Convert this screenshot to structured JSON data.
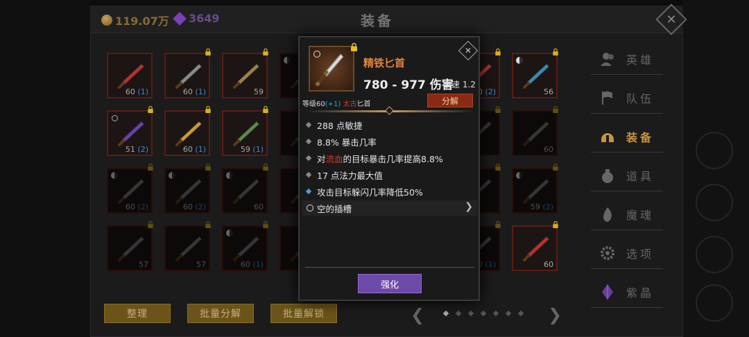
{
  "header": {
    "gold": "119.07万",
    "gems": "3649",
    "title": "装备"
  },
  "grid": {
    "slots": [
      {
        "level": "60",
        "bonus": "(1)",
        "lock": false,
        "ring": false,
        "yin": false,
        "dim": false,
        "color": "#b83030"
      },
      {
        "level": "60",
        "bonus": "(1)",
        "lock": true,
        "ring": false,
        "yin": false,
        "dim": false,
        "color": "#8a8a8a"
      },
      {
        "level": "59",
        "bonus": "",
        "lock": true,
        "ring": false,
        "yin": false,
        "dim": false,
        "color": "#a0804a"
      },
      {
        "level": "",
        "bonus": "",
        "lock": false,
        "ring": false,
        "yin": true,
        "dim": true,
        "color": "#777"
      },
      {
        "level": "60",
        "bonus": "(2)",
        "lock": true,
        "ring": false,
        "yin": false,
        "dim": false,
        "color": "#aa3535"
      },
      {
        "level": "56",
        "bonus": "",
        "lock": true,
        "ring": false,
        "yin": true,
        "dim": false,
        "color": "#3a8ab0"
      },
      {
        "level": "51",
        "bonus": "(2)",
        "lock": true,
        "ring": true,
        "yin": false,
        "dim": false,
        "color": "#6a3fb0"
      },
      {
        "level": "60",
        "bonus": "(1)",
        "lock": true,
        "ring": false,
        "yin": false,
        "dim": false,
        "color": "#c99a35"
      },
      {
        "level": "59",
        "bonus": "(1)",
        "lock": true,
        "ring": false,
        "yin": false,
        "dim": false,
        "color": "#5a8a4a"
      },
      {
        "level": "",
        "bonus": "",
        "lock": false,
        "ring": false,
        "yin": false,
        "dim": true,
        "color": "#777"
      },
      {
        "level": "",
        "bonus": "",
        "lock": true,
        "ring": false,
        "yin": false,
        "dim": true,
        "color": "#777"
      },
      {
        "level": "60",
        "bonus": "",
        "lock": true,
        "ring": false,
        "yin": false,
        "dim": true,
        "color": "#777"
      },
      {
        "level": "60",
        "bonus": "(2)",
        "lock": true,
        "ring": false,
        "yin": true,
        "dim": true,
        "color": "#777"
      },
      {
        "level": "60",
        "bonus": "(2)",
        "lock": true,
        "ring": false,
        "yin": true,
        "dim": true,
        "color": "#777"
      },
      {
        "level": "60",
        "bonus": "",
        "lock": true,
        "ring": false,
        "yin": true,
        "dim": true,
        "color": "#777"
      },
      {
        "level": "",
        "bonus": "",
        "lock": false,
        "ring": false,
        "yin": false,
        "dim": true,
        "color": "#777"
      },
      {
        "level": "",
        "bonus": "",
        "lock": true,
        "ring": false,
        "yin": false,
        "dim": true,
        "color": "#777"
      },
      {
        "level": "59",
        "bonus": "(2)",
        "lock": true,
        "ring": false,
        "yin": true,
        "dim": true,
        "color": "#777"
      },
      {
        "level": "57",
        "bonus": "",
        "lock": true,
        "ring": false,
        "yin": false,
        "dim": true,
        "color": "#777"
      },
      {
        "level": "57",
        "bonus": "",
        "lock": true,
        "ring": false,
        "yin": false,
        "dim": true,
        "color": "#777"
      },
      {
        "level": "60",
        "bonus": "(1)",
        "lock": true,
        "ring": false,
        "yin": true,
        "dim": true,
        "color": "#777"
      },
      {
        "level": "",
        "bonus": "",
        "lock": false,
        "ring": false,
        "yin": false,
        "dim": true,
        "color": "#777"
      },
      {
        "level": "60",
        "bonus": "(1)",
        "lock": true,
        "ring": false,
        "yin": false,
        "dim": true,
        "color": "#777"
      },
      {
        "level": "60",
        "bonus": "",
        "lock": true,
        "ring": false,
        "yin": false,
        "dim": false,
        "color": "#b83030"
      }
    ]
  },
  "bottom": {
    "sort": "整理",
    "bulk_dismantle": "批量分解",
    "bulk_unlock": "批量解锁",
    "prev": "❮",
    "next": "❯"
  },
  "tabs": [
    {
      "label": "英雄",
      "icon": "hero-icon"
    },
    {
      "label": "队伍",
      "icon": "flag-icon"
    },
    {
      "label": "装备",
      "icon": "helmet-icon",
      "active": true
    },
    {
      "label": "道具",
      "icon": "bag-icon"
    },
    {
      "label": "魔魂",
      "icon": "flame-icon"
    },
    {
      "label": "选项",
      "icon": "gear-icon"
    },
    {
      "label": "紫晶",
      "icon": "crystal-icon"
    }
  ],
  "tooltip": {
    "name": "精铁匕首",
    "damage": "780 - 977 伤害",
    "speed_label": "攻速",
    "speed": "1.2",
    "level_prefix": "等级60",
    "level_plus": "(+1)",
    "quality": "太古",
    "type": "匕首",
    "dismantle": "分解",
    "stats": [
      {
        "text": "288 点敏捷"
      },
      {
        "text": "8.8% 暴击几率"
      },
      {
        "pre": "对",
        "red": "流血",
        "post": "的目标暴击几率提高8.8%"
      },
      {
        "text": "17 点法力最大值"
      },
      {
        "text": "攻击目标躲闪几率降低50%",
        "blue": true
      }
    ],
    "socket": "空的插槽",
    "upgrade": "强化"
  },
  "colors": {
    "accent_orange": "#e3843b",
    "gold_button": "#6a5419",
    "purple_button": "#6e4aa8",
    "dismantle_red": "#8a2a14",
    "slot_border": "#5a1d14"
  }
}
